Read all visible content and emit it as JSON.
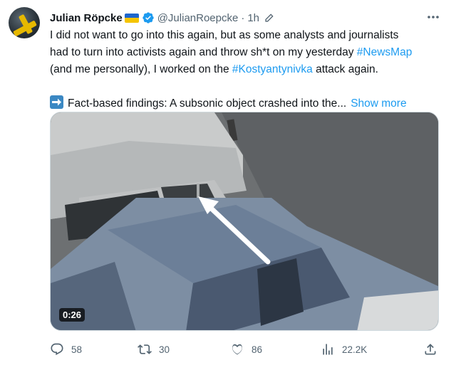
{
  "tweet": {
    "author_name": "Julian Röpcke",
    "handle": "@JulianRoepcke",
    "separator": "·",
    "time": "1h",
    "lines": {
      "l1": "I did not want to go into this again, but as some analysts and journalists",
      "l2_pre": "had to turn into activists again and throw sh*t on my yesterday ",
      "l2_tag": "#NewsMap",
      "l3_pre": "(and me personally), I worked on the ",
      "l3_tag": "#Kostyantynivka",
      "l3_post": " attack again.",
      "l4": "Fact-based findings: A subsonic object crashed into the...",
      "show_more": "Show more"
    },
    "media": {
      "duration": "0:26"
    },
    "stats": {
      "replies": "58",
      "reposts": "30",
      "likes": "86",
      "views": "22.2K"
    },
    "icons": {
      "verified": "verified-badge-icon",
      "edited": "pencil-icon",
      "more": "more-icon",
      "reply": "reply-icon",
      "repost": "repost-icon",
      "like": "heart-icon",
      "views": "views-icon",
      "share": "share-icon"
    },
    "colors": {
      "link": "#1d9bf0",
      "secondary_text": "#536471",
      "verified_badge": "#1d9bf0"
    }
  }
}
